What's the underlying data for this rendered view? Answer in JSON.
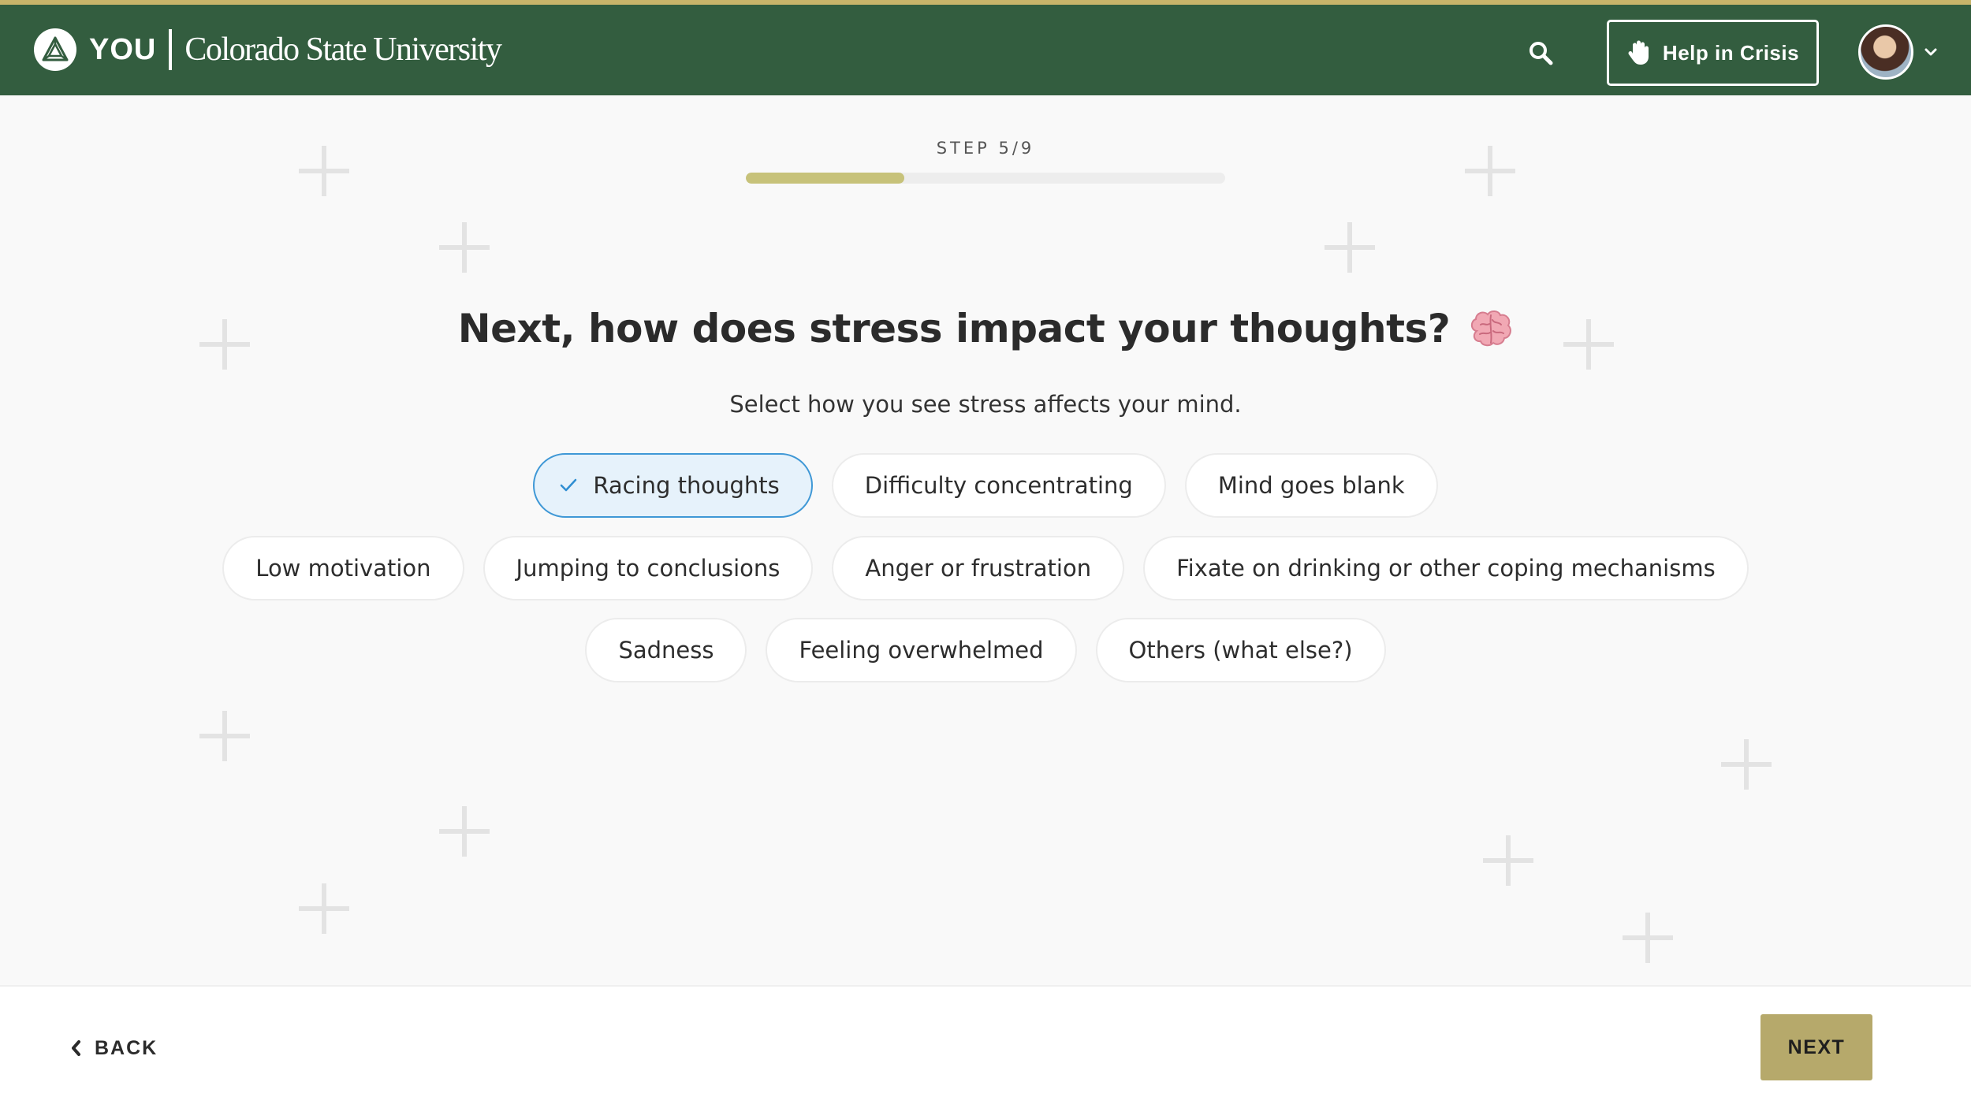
{
  "header": {
    "brand_short": "YOU",
    "brand_university": "Colorado State University",
    "crisis_label": "Help in Crisis",
    "colors": {
      "bar": "#335d3f",
      "accent_stripe": "#c8b46a"
    }
  },
  "step": {
    "label": "STEP 5/9",
    "current": 5,
    "total": 9,
    "progress_fraction": 0.33
  },
  "question": {
    "title": "Next, how does stress impact your thoughts?",
    "emoji_icon": "brain-icon",
    "subtitle": "Select how you see stress affects your mind."
  },
  "options": [
    {
      "label": "Racing thoughts",
      "selected": true
    },
    {
      "label": "Difficulty concentrating",
      "selected": false
    },
    {
      "label": "Mind goes blank",
      "selected": false
    },
    {
      "label": "Low motivation",
      "selected": false
    },
    {
      "label": "Jumping to conclusions",
      "selected": false
    },
    {
      "label": "Anger or frustration",
      "selected": false
    },
    {
      "label": "Fixate on drinking or other coping mechanisms",
      "selected": false
    },
    {
      "label": "Sadness",
      "selected": false
    },
    {
      "label": "Feeling overwhelmed",
      "selected": false
    },
    {
      "label": "Others (what else?)",
      "selected": false
    }
  ],
  "footer": {
    "back_label": "BACK",
    "next_label": "NEXT",
    "next_color": "#b6a96b"
  }
}
